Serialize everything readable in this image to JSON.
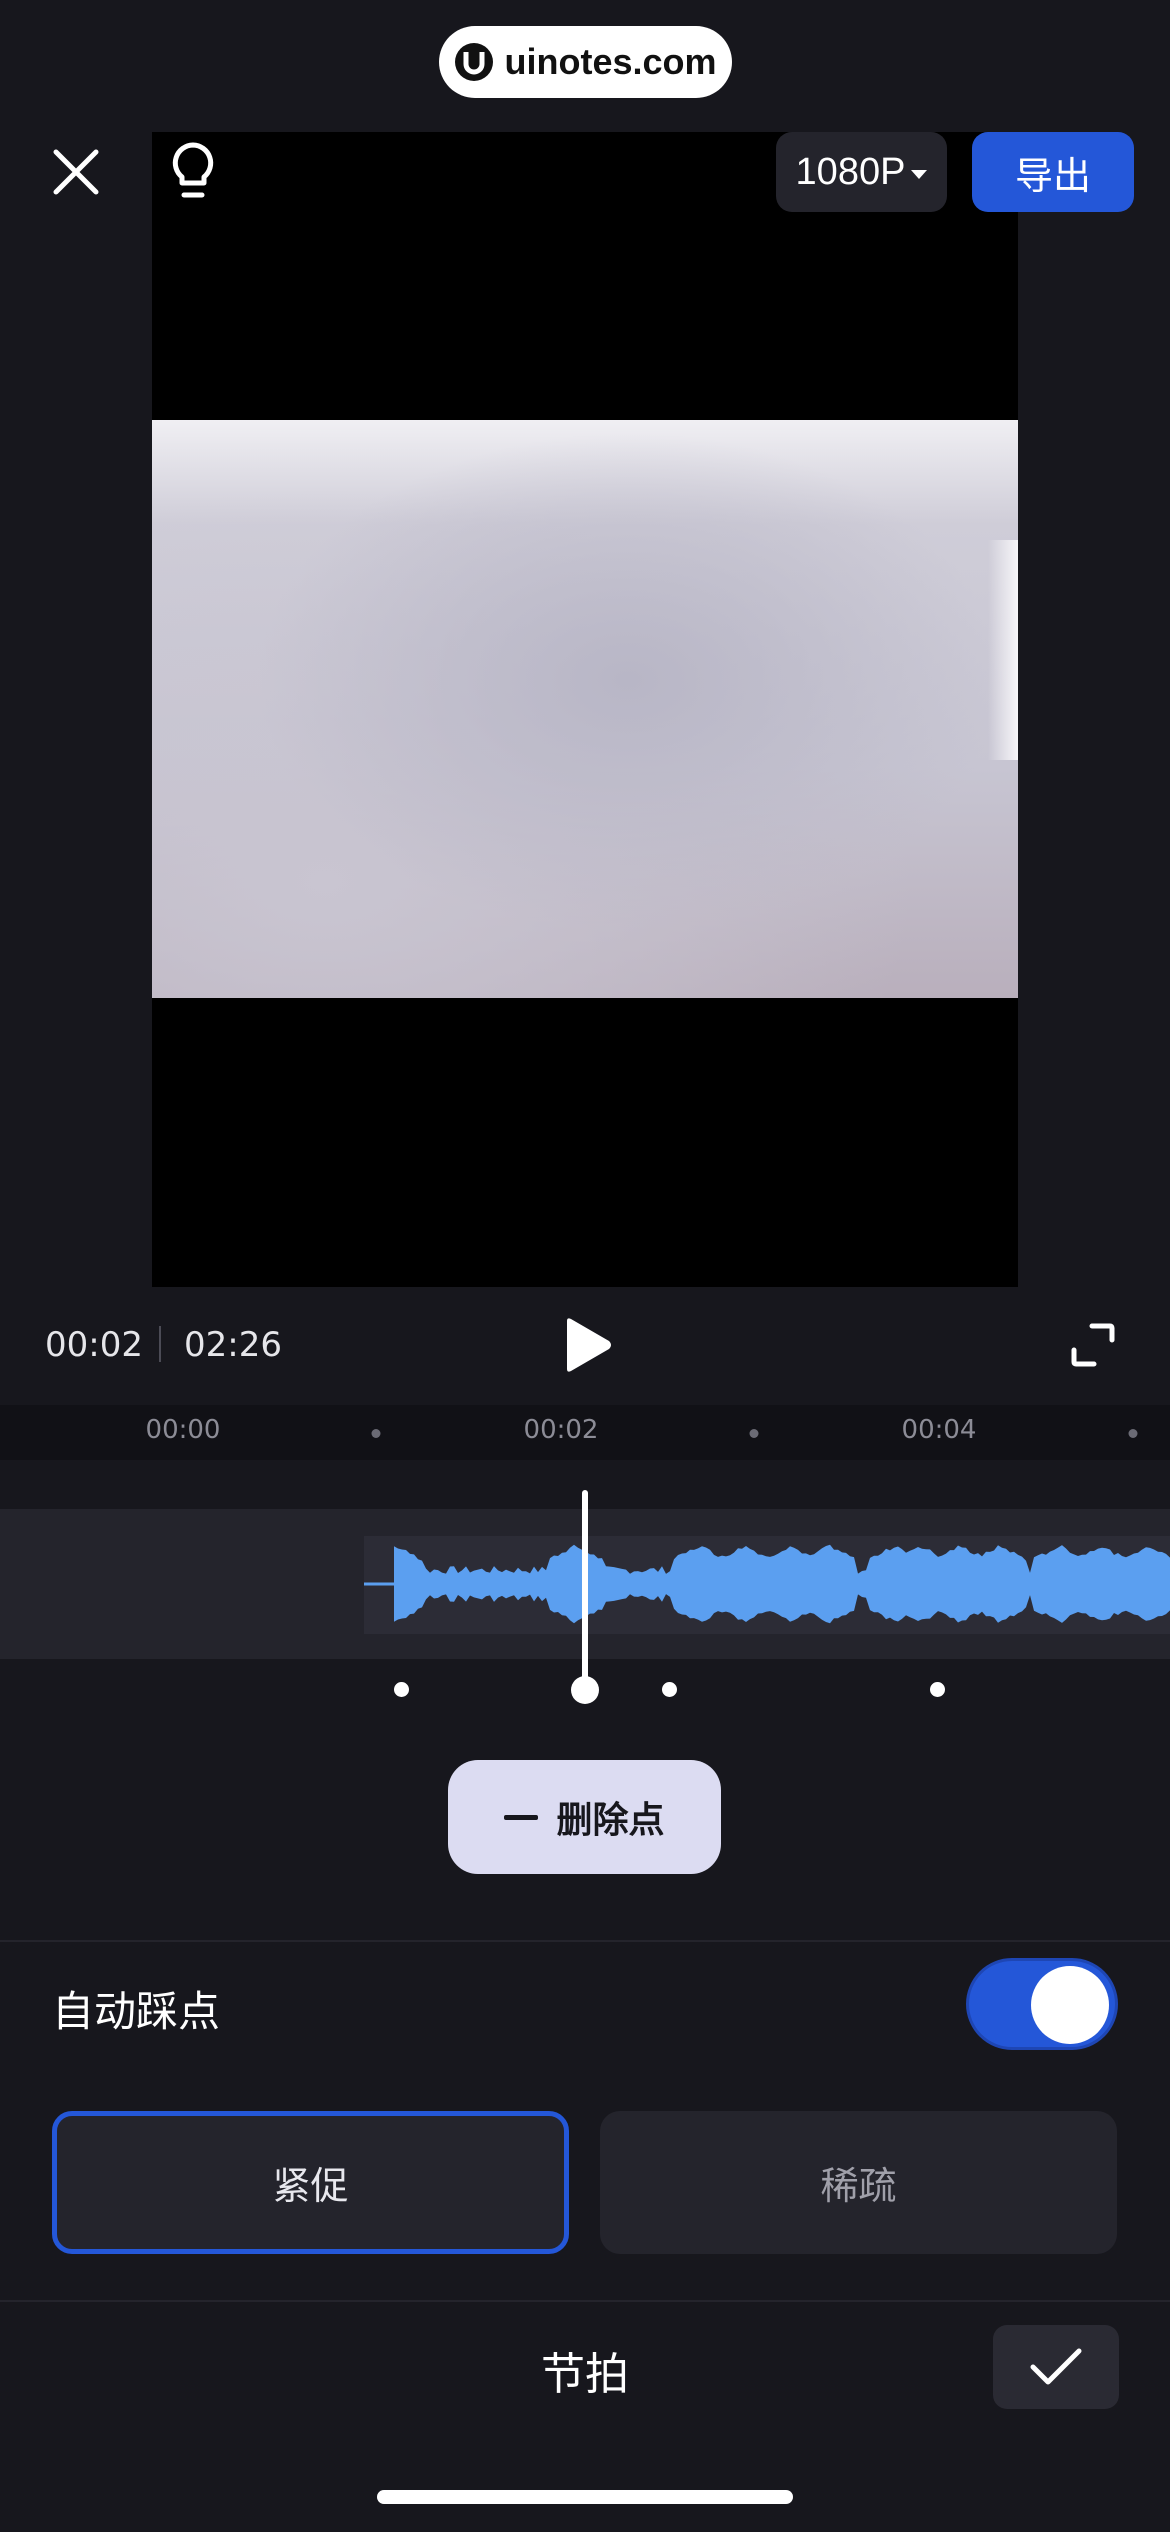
{
  "watermark": {
    "text": "uinotes.com"
  },
  "header": {
    "resolution": "1080P",
    "export_label": "导出"
  },
  "playback": {
    "current_time": "00:02",
    "total_time": "02:26"
  },
  "ruler": {
    "labels": [
      "00:00",
      "00:02",
      "00:04"
    ]
  },
  "beat_editor": {
    "delete_point_label": "删除点"
  },
  "auto_beat": {
    "label": "自动踩点",
    "enabled": true,
    "options": [
      {
        "label": "紧促",
        "selected": true
      },
      {
        "label": "稀疏",
        "selected": false
      }
    ]
  },
  "footer": {
    "title": "节拍"
  },
  "colors": {
    "accent": "#2457d8",
    "waveform": "#5b9ff0",
    "background": "#17171d"
  }
}
